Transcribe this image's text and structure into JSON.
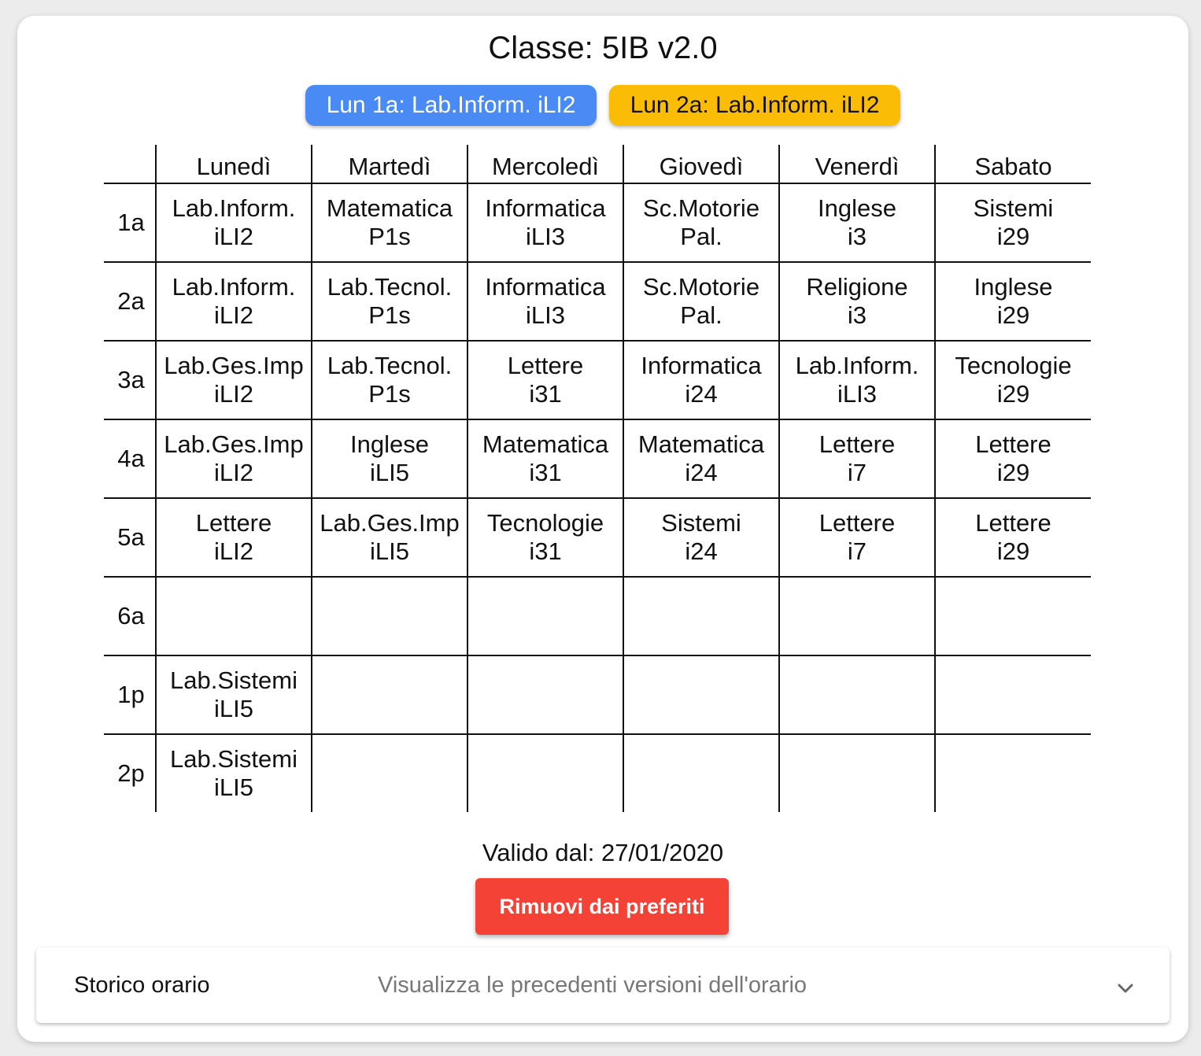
{
  "title": "Classe: 5IB v2.0",
  "chips": [
    {
      "label": "Lun 1a: Lab.Inform. iLI2",
      "color": "#4a8af4"
    },
    {
      "label": "Lun 2a: Lab.Inform. iLI2",
      "color": "#fbbc05"
    }
  ],
  "schedule": {
    "days": [
      "Lunedì",
      "Martedì",
      "Mercoledì",
      "Giovedì",
      "Venerdì",
      "Sabato"
    ],
    "rows": [
      {
        "hour": "1a",
        "cells": [
          {
            "subject": "Lab.Inform.",
            "room": "iLI2"
          },
          {
            "subject": "Matematica",
            "room": "P1s"
          },
          {
            "subject": "Informatica",
            "room": "iLI3"
          },
          {
            "subject": "Sc.Motorie",
            "room": "Pal."
          },
          {
            "subject": "Inglese",
            "room": "i3"
          },
          {
            "subject": "Sistemi",
            "room": "i29"
          }
        ]
      },
      {
        "hour": "2a",
        "cells": [
          {
            "subject": "Lab.Inform.",
            "room": "iLI2"
          },
          {
            "subject": "Lab.Tecnol.",
            "room": "P1s"
          },
          {
            "subject": "Informatica",
            "room": "iLI3"
          },
          {
            "subject": "Sc.Motorie",
            "room": "Pal."
          },
          {
            "subject": "Religione",
            "room": "i3"
          },
          {
            "subject": "Inglese",
            "room": "i29"
          }
        ]
      },
      {
        "hour": "3a",
        "cells": [
          {
            "subject": "Lab.Ges.Imp",
            "room": "iLI2"
          },
          {
            "subject": "Lab.Tecnol.",
            "room": "P1s"
          },
          {
            "subject": "Lettere",
            "room": "i31"
          },
          {
            "subject": "Informatica",
            "room": "i24"
          },
          {
            "subject": "Lab.Inform.",
            "room": "iLI3"
          },
          {
            "subject": "Tecnologie",
            "room": "i29"
          }
        ]
      },
      {
        "hour": "4a",
        "cells": [
          {
            "subject": "Lab.Ges.Imp",
            "room": "iLI2"
          },
          {
            "subject": "Inglese",
            "room": "iLI5"
          },
          {
            "subject": "Matematica",
            "room": "i31"
          },
          {
            "subject": "Matematica",
            "room": "i24"
          },
          {
            "subject": "Lettere",
            "room": "i7"
          },
          {
            "subject": "Lettere",
            "room": "i29"
          }
        ]
      },
      {
        "hour": "5a",
        "cells": [
          {
            "subject": "Lettere",
            "room": "iLI2"
          },
          {
            "subject": "Lab.Ges.Imp",
            "room": "iLI5"
          },
          {
            "subject": "Tecnologie",
            "room": "i31"
          },
          {
            "subject": "Sistemi",
            "room": "i24"
          },
          {
            "subject": "Lettere",
            "room": "i7"
          },
          {
            "subject": "Lettere",
            "room": "i29"
          }
        ]
      },
      {
        "hour": "6a",
        "cells": [
          {
            "subject": "",
            "room": ""
          },
          {
            "subject": "",
            "room": ""
          },
          {
            "subject": "",
            "room": ""
          },
          {
            "subject": "",
            "room": ""
          },
          {
            "subject": "",
            "room": ""
          },
          {
            "subject": "",
            "room": ""
          }
        ]
      },
      {
        "hour": "1p",
        "cells": [
          {
            "subject": "Lab.Sistemi",
            "room": "iLI5"
          },
          {
            "subject": "",
            "room": ""
          },
          {
            "subject": "",
            "room": ""
          },
          {
            "subject": "",
            "room": ""
          },
          {
            "subject": "",
            "room": ""
          },
          {
            "subject": "",
            "room": ""
          }
        ]
      },
      {
        "hour": "2p",
        "cells": [
          {
            "subject": "Lab.Sistemi",
            "room": "iLI5"
          },
          {
            "subject": "",
            "room": ""
          },
          {
            "subject": "",
            "room": ""
          },
          {
            "subject": "",
            "room": ""
          },
          {
            "subject": "",
            "room": ""
          },
          {
            "subject": "",
            "room": ""
          }
        ]
      }
    ]
  },
  "valid_from": "Valido dal: 27/01/2020",
  "remove_button": {
    "label": "Rimuovi dai preferiti",
    "color": "#f44336"
  },
  "history": {
    "title": "Storico orario",
    "subtitle": "Visualizza le precedenti versioni dell'orario",
    "icon": "chevron-down-icon"
  }
}
